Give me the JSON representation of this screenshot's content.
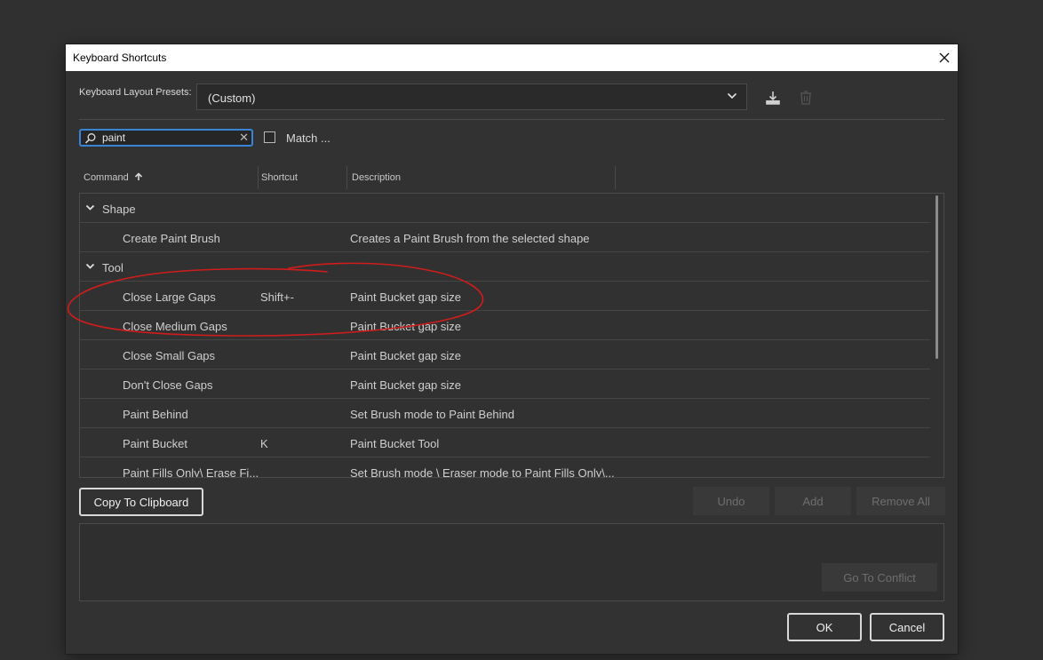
{
  "dialog": {
    "title": "Keyboard Shortcuts",
    "close_icon": "close-icon"
  },
  "presets": {
    "label": "Keyboard Layout Presets:",
    "value": "(Custom)",
    "save_icon": "save-download-icon",
    "delete_icon": "trash-icon"
  },
  "search": {
    "value": "paint",
    "icon": "search-icon",
    "clear_icon": "clear-icon",
    "match_label": "Match ..."
  },
  "columns": {
    "command": "Command",
    "shortcut": "Shortcut",
    "description": "Description",
    "sort_icon": "sort-ascending-icon"
  },
  "rows": [
    {
      "type": "group",
      "label": "Shape"
    },
    {
      "type": "item",
      "command": "Create Paint Brush",
      "shortcut": "",
      "description": "Creates a Paint Brush from the selected shape"
    },
    {
      "type": "group",
      "label": "Tool"
    },
    {
      "type": "item",
      "command": "Close Large Gaps",
      "shortcut": "Shift+-",
      "description": "Paint Bucket gap size"
    },
    {
      "type": "item",
      "command": "Close Medium Gaps",
      "shortcut": "",
      "description": "Paint Bucket gap size"
    },
    {
      "type": "item",
      "command": "Close Small Gaps",
      "shortcut": "",
      "description": "Paint Bucket gap size"
    },
    {
      "type": "item",
      "command": "Don't Close Gaps",
      "shortcut": "",
      "description": "Paint Bucket gap size"
    },
    {
      "type": "item",
      "command": "Paint Behind",
      "shortcut": "",
      "description": "Set Brush mode to Paint Behind"
    },
    {
      "type": "item",
      "command": "Paint Bucket",
      "shortcut": "K",
      "description": "Paint Bucket Tool"
    },
    {
      "type": "item",
      "command": "Paint Fills Only\\ Erase Fi...",
      "shortcut": "",
      "description": "Set Brush mode \\ Eraser mode to Paint Fills Only\\..."
    }
  ],
  "buttons": {
    "copy": "Copy To Clipboard",
    "undo": "Undo",
    "add": "Add",
    "remove_all": "Remove All",
    "go_to_conflict": "Go To Conflict",
    "ok": "OK",
    "cancel": "Cancel"
  },
  "colors": {
    "accent": "#3a84d8",
    "annotation": "#d01c1c"
  }
}
